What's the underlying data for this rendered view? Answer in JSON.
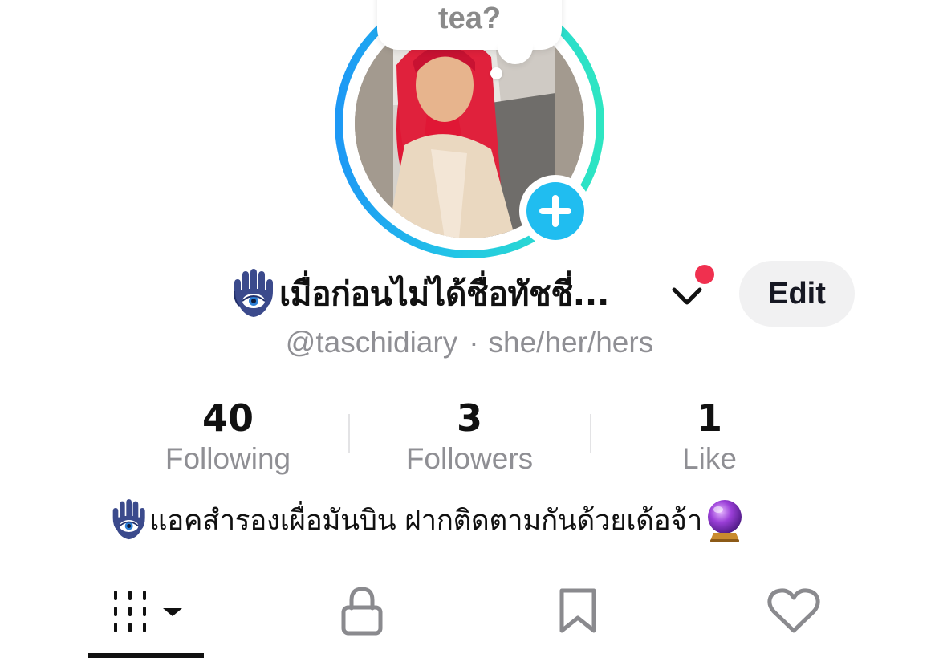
{
  "story": {
    "bubble_text": "tea?"
  },
  "profile": {
    "display_name": "เมื่อก่อนไม่ได้ชื่อทัชชี่...",
    "username": "@taschidiary",
    "separator": "·",
    "pronouns": "she/her/hers",
    "edit_label": "Edit",
    "name_icon": "hamsa-icon",
    "switch_icon": "chevron-down-icon"
  },
  "stats": [
    {
      "count": "40",
      "label": "Following"
    },
    {
      "count": "3",
      "label": "Followers"
    },
    {
      "count": "1",
      "label": "Like"
    }
  ],
  "bio": {
    "text": "แอคสำรองเผื่อมันบิน ฝากติดตามกันด้วยเด้อจ้า",
    "leading_icon": "hamsa-icon",
    "trailing_icon": "crystal-ball-icon"
  },
  "tabs": [
    {
      "name": "videos",
      "icon": "grid-icon",
      "selected": true
    },
    {
      "name": "private",
      "icon": "lock-icon",
      "selected": false
    },
    {
      "name": "favorites",
      "icon": "bookmark-icon",
      "selected": false
    },
    {
      "name": "liked",
      "icon": "heart-icon",
      "selected": false
    }
  ],
  "colors": {
    "ring_start": "#1d97f5",
    "ring_end": "#2ee6c1",
    "add_button": "#20bdf0",
    "notification_dot": "#f0304f",
    "muted_text": "#8f8f94",
    "edit_button_bg": "#f1f1f2"
  }
}
